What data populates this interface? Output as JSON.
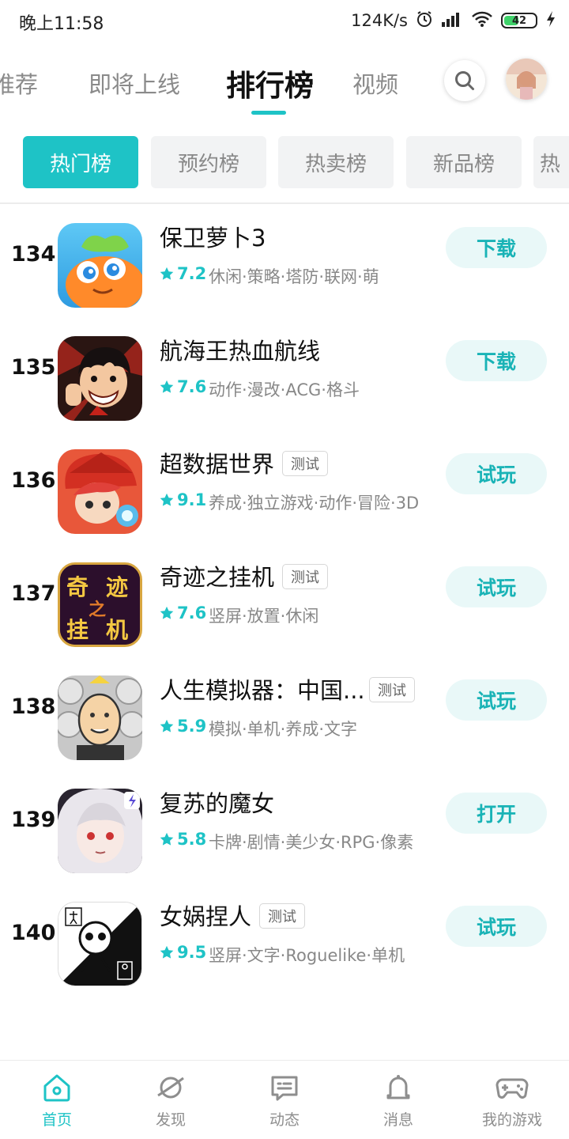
{
  "status_bar": {
    "time": "晚上11:58",
    "network_speed": "124K/s",
    "battery_level": "42",
    "battery_fill": 0.42
  },
  "top_tabs": [
    {
      "label": "推荐",
      "active": false
    },
    {
      "label": "即将上线",
      "active": false
    },
    {
      "label": "排行榜",
      "active": true
    },
    {
      "label": "视频",
      "active": false
    }
  ],
  "chips": [
    {
      "label": "热门榜",
      "active": true
    },
    {
      "label": "预约榜",
      "active": false
    },
    {
      "label": "热卖榜",
      "active": false
    },
    {
      "label": "新品榜",
      "active": false
    },
    {
      "label": "热",
      "active": false
    }
  ],
  "apps": [
    {
      "rank": "134",
      "name": "保卫萝卜3",
      "badge": "",
      "rating": "7.2",
      "tags": "休闲·策略·塔防·联网·萌",
      "action": "下载"
    },
    {
      "rank": "135",
      "name": "航海王热血航线",
      "badge": "",
      "rating": "7.6",
      "tags": "动作·漫改·ACG·格斗",
      "action": "下载"
    },
    {
      "rank": "136",
      "name": "超数据世界",
      "badge": "测试",
      "rating": "9.1",
      "tags": "养成·独立游戏·动作·冒险·3D",
      "action": "试玩"
    },
    {
      "rank": "137",
      "name": "奇迹之挂机",
      "badge": "测试",
      "rating": "7.6",
      "tags": "竖屏·放置·休闲",
      "action": "试玩"
    },
    {
      "rank": "138",
      "name": "人生模拟器：中国...",
      "badge": "测试",
      "rating": "5.9",
      "tags": "模拟·单机·养成·文字",
      "action": "试玩"
    },
    {
      "rank": "139",
      "name": "复苏的魔女",
      "badge": "",
      "rating": "5.8",
      "tags": "卡牌·剧情·美少女·RPG·像素",
      "action": "打开"
    },
    {
      "rank": "140",
      "name": "女娲捏人",
      "badge": "测试",
      "rating": "9.5",
      "tags": "竖屏·文字·Roguelike·单机",
      "action": "试玩"
    }
  ],
  "icon_text": {
    "qiji": [
      "奇",
      "迹",
      "之",
      "挂",
      "机"
    ]
  },
  "bottom_nav": [
    {
      "label": "首页",
      "icon": "home-icon",
      "active": true
    },
    {
      "label": "发现",
      "icon": "planet-icon",
      "active": false
    },
    {
      "label": "动态",
      "icon": "chat-icon",
      "active": false
    },
    {
      "label": "消息",
      "icon": "bell-icon",
      "active": false
    },
    {
      "label": "我的游戏",
      "icon": "gamepad-icon",
      "active": false
    }
  ],
  "colors": {
    "accent": "#1ec3c6",
    "action_bg": "#e9f8f8",
    "chip_bg": "#f2f3f4"
  }
}
